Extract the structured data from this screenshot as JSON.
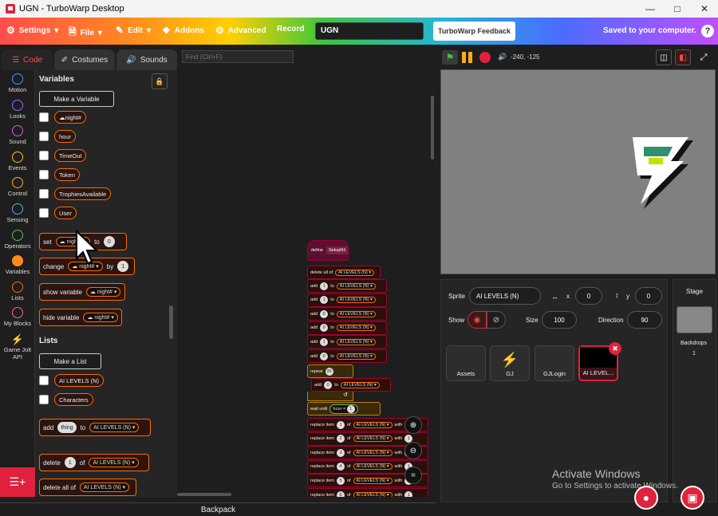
{
  "window": {
    "title": "UGN - TurboWarp Desktop"
  },
  "menu": {
    "settings": "Settings",
    "file": "File",
    "edit": "Edit",
    "addons": "Addons",
    "advanced": "Advanced",
    "record": "Record",
    "project_name": "UGN",
    "feedback": "TurboWarp Feedback",
    "saved": "Saved to your computer.",
    "help": "?"
  },
  "tabs": {
    "code": "Code",
    "costumes": "Costumes",
    "sounds": "Sounds",
    "find_placeholder": "Find (Ctrl+F)"
  },
  "categories": [
    {
      "label": "Motion",
      "color": "#4c97ff"
    },
    {
      "label": "Looks",
      "color": "#9966ff"
    },
    {
      "label": "Sound",
      "color": "#cf63cf"
    },
    {
      "label": "Events",
      "color": "#ffbf00"
    },
    {
      "label": "Control",
      "color": "#ffab19"
    },
    {
      "label": "Sensing",
      "color": "#5cb1d6"
    },
    {
      "label": "Operators",
      "color": "#59c059"
    },
    {
      "label": "Variables",
      "color": "#ff8c1a"
    },
    {
      "label": "Lists",
      "color": "#ff661a"
    },
    {
      "label": "My Blocks",
      "color": "#ff6680"
    },
    {
      "label": "Game Jolt API",
      "color": "#2f7f6f"
    }
  ],
  "palette": {
    "variables_header": "Variables",
    "make_variable": "Make a Variable",
    "variables": [
      "night#",
      "hour",
      "TimeOut",
      "Token",
      "TrophiesAvailable",
      "User"
    ],
    "set_block": {
      "label": "set",
      "var": "night#",
      "to": "to",
      "value": "0"
    },
    "change_block": {
      "label": "change",
      "var": "night#",
      "by": "by",
      "value": "1"
    },
    "show_block": {
      "label": "show variable",
      "var": "night#"
    },
    "hide_block": {
      "label": "hide variable",
      "var": "night#"
    },
    "lists_header": "Lists",
    "make_list": "Make a List",
    "lists": [
      "AI LEVELS (N)",
      "Characters"
    ],
    "add_block": {
      "label": "add",
      "item": "thing",
      "to": "to",
      "list": "AI LEVELS (N)"
    },
    "delete_block": {
      "label": "delete",
      "value": "1",
      "of": "of",
      "list": "AI LEVELS (N)"
    },
    "delete_all_block": {
      "label": "delete all of",
      "list": "AI LEVELS (N)"
    }
  },
  "script": {
    "define": "define",
    "proc": "SetupN1",
    "delete_all": "delete all of",
    "list": "AI LEVELS (N)",
    "add": "add",
    "to": "to",
    "add_values": [
      "1",
      "1",
      "0",
      "0",
      "1",
      "0"
    ],
    "repeat": "repeat",
    "repeat_count": "35",
    "inner_add_value": "0",
    "wait_until": "wait until",
    "hour": "hour",
    "eq": "=",
    "eq_value": "1",
    "replace": "replace item",
    "of": "of",
    "with": "with",
    "replace_items": [
      {
        "idx": "1",
        "with": "1"
      },
      {
        "idx": "2",
        "with": "1"
      },
      {
        "idx": "3",
        "with": "1"
      },
      {
        "idx": "4",
        "with": "1"
      },
      {
        "idx": "5",
        "with": "1"
      },
      {
        "idx": "6",
        "with": "1"
      }
    ]
  },
  "backpack": "Backpack",
  "stage": {
    "coords": "-240, -125"
  },
  "sprite_panel": {
    "sprite_label": "Sprite",
    "sprite_name": "AI LEVELS (N)",
    "x_label": "x",
    "x_value": "0",
    "y_label": "y",
    "y_value": "0",
    "show_label": "Show",
    "size_label": "Size",
    "size_value": "100",
    "direction_label": "Direction",
    "direction_value": "90",
    "sprites": [
      "Assets",
      "GJ",
      "GJLogin",
      "AI LEVEL..."
    ]
  },
  "stage_panel": {
    "title": "Stage",
    "backdrops_label": "Backdrops",
    "backdrops_count": "1"
  },
  "watermark": {
    "line1": "Activate Windows",
    "line2": "Go to Settings to activate Windows."
  },
  "colors": {
    "accent": "#ff4c4c",
    "variables": "#ff8c1a",
    "selected_sprite": "#e0223c"
  }
}
